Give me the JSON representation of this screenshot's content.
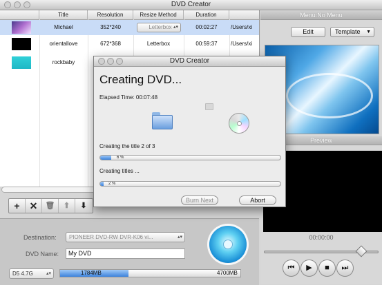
{
  "window": {
    "title": "DVD Creator"
  },
  "table": {
    "columns": [
      "Title",
      "Resolution",
      "Resize Method",
      "Duration",
      ""
    ],
    "rows": [
      {
        "title": "Michael",
        "resolution": "352*240",
        "resize": "Letterbox",
        "duration": "00:02:27",
        "path": "/Users/xi",
        "selected": true
      },
      {
        "title": "orientallove",
        "resolution": "672*368",
        "resize": "Letterbox",
        "duration": "00:59:37",
        "path": "/Users/xi",
        "selected": false
      },
      {
        "title": "rockbaby",
        "resolution": "",
        "resize": "",
        "duration": "",
        "path": "",
        "selected": false
      }
    ]
  },
  "toolbar": {
    "add_icon": "plus-icon",
    "remove_icon": "x-icon",
    "trash_icon": "trash-icon",
    "up_icon": "arrow-up-icon",
    "down_icon": "arrow-down-icon"
  },
  "bottom": {
    "destination_label": "Destination:",
    "destination_value": "PIONEER DVD-RW  DVR-K06 vi...",
    "dvd_name_label": "DVD Name:",
    "dvd_name_value": "My DVD",
    "disc_type": "D5 4.7G",
    "used_size": "1784MB",
    "capacity": "4700MB",
    "used_fraction": 0.38
  },
  "right": {
    "menu_header": "Menu:No Menu",
    "edit_label": "Edit",
    "template_label": "Template",
    "preview_header": "Preview",
    "timecode": "00:00:00",
    "slider_fraction": 0.85
  },
  "dialog": {
    "title": "DVD Creator",
    "heading": "Creating DVD...",
    "elapsed": "Elapsed Time: 00:07:48",
    "status1": "Creating the title 2 of 3",
    "progress1": "6 %",
    "progress1_value": 6,
    "status2": "Creating titles ...",
    "progress2": "2 %",
    "progress2_value": 2,
    "burn_next_label": "Burn Next",
    "abort_label": "Abort"
  },
  "colors": {
    "selection": "#c9dcf7",
    "progress_fill": "#3c82dc",
    "preview_bg": "#000000"
  }
}
